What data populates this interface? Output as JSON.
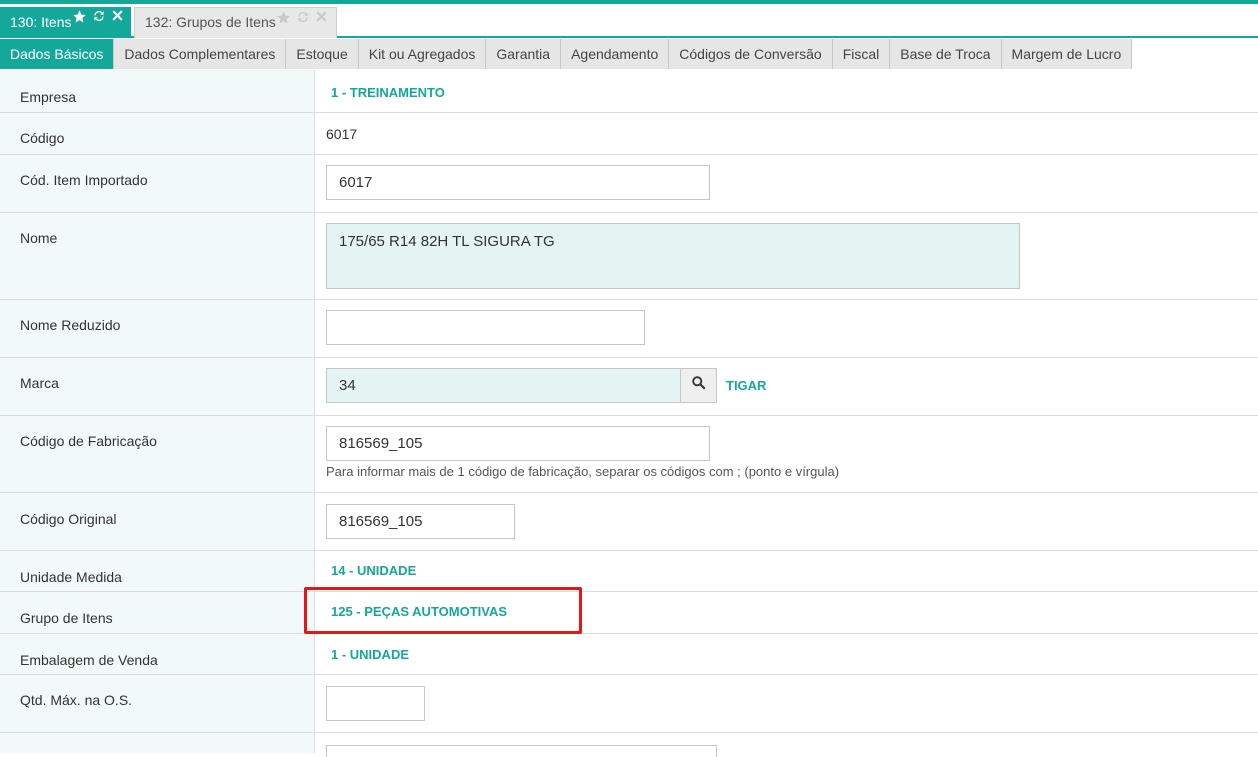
{
  "doc_tabs": [
    {
      "label": "130: Itens",
      "active": true
    },
    {
      "label": "132: Grupos de Itens",
      "active": false
    }
  ],
  "sub_tabs": [
    "Dados Básicos",
    "Dados Complementares",
    "Estoque",
    "Kit ou Agregados",
    "Garantia",
    "Agendamento",
    "Códigos de Conversão",
    "Fiscal",
    "Base de Troca",
    "Margem de Lucro"
  ],
  "form": {
    "empresa": {
      "label": "Empresa",
      "value": "1 - TREINAMENTO"
    },
    "codigo": {
      "label": "Código",
      "value": "6017"
    },
    "cod_item_importado": {
      "label": "Cód. Item Importado",
      "value": "6017"
    },
    "nome": {
      "label": "Nome",
      "value": "175/65 R14 82H TL SIGURA TG"
    },
    "nome_reduzido": {
      "label": "Nome Reduzido",
      "value": ""
    },
    "marca": {
      "label": "Marca",
      "value": "34",
      "description": "TIGAR"
    },
    "codigo_fabricacao": {
      "label": "Código de Fabricação",
      "value": "816569_105",
      "hint": "Para informar mais de 1 código de fabricação, separar os códigos com ; (ponto e vírgula)"
    },
    "codigo_original": {
      "label": "Código Original",
      "value": "816569_105"
    },
    "unidade_medida": {
      "label": "Unidade Medida",
      "value": "14 - UNIDADE"
    },
    "grupo_itens": {
      "label": "Grupo de Itens",
      "value": "125 - PEÇAS AUTOMOTIVAS"
    },
    "embalagem_venda": {
      "label": "Embalagem de Venda",
      "value": "1 - UNIDADE"
    },
    "qtd_max_os": {
      "label": "Qtd. Máx. na O.S.",
      "value": ""
    }
  },
  "colors": {
    "accent": "#14a89a",
    "highlight": "#e8141a",
    "input_tint": "#e3f4f3"
  },
  "icons": [
    "star-icon",
    "refresh-icon",
    "close-icon",
    "search-icon"
  ]
}
